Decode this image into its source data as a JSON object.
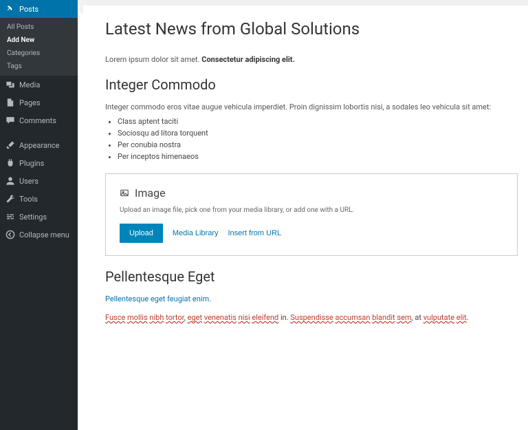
{
  "sidebar": {
    "posts": {
      "label": "Posts"
    },
    "sub": {
      "all": "All Posts",
      "add": "Add New",
      "cat": "Categories",
      "tags": "Tags"
    },
    "media": "Media",
    "pages": "Pages",
    "comments": "Comments",
    "appearance": "Appearance",
    "plugins": "Plugins",
    "users": "Users",
    "tools": "Tools",
    "settings": "Settings",
    "collapse": "Collapse menu"
  },
  "content": {
    "title": "Latest News from Global Solutions",
    "intro_plain": "Lorem ipsum dolor sit amet. ",
    "intro_bold": "Consectetur adipiscing elit.",
    "h2a": "Integer Commodo",
    "p2": "Integer commodo eros vitae augue vehicula imperdiet. Proin dignissim lobortis nisi, a sodales leo vehicula sit amet:",
    "bullets": [
      "Class aptent taciti",
      "Sociosqu ad litora torquent",
      "Per conubia nostra",
      "Per inceptos himenaeos"
    ],
    "image_block": {
      "label": "Image",
      "desc": "Upload an image file, pick one from your media library, or add one with a URL.",
      "upload": "Upload",
      "media_library": "Media Library",
      "insert_url": "Insert from URL"
    },
    "h2b": "Pellentesque Eget",
    "link_para": "Pellentesque eget feugiat enim.",
    "spell": {
      "w1": "Fusce",
      "w2": "mollis",
      "w3": "nibh",
      "w4": "tortor",
      "c1": ", ",
      "w5": "eget",
      "w6": "venenatis",
      "w7": "nisi",
      "w8": "eleifend",
      "p1": " in. ",
      "w9": "Suspendisse",
      "w10": "accumsan",
      "w11": "blandit",
      "w12": "sem",
      "c2": ", at ",
      "w13": "vulputate",
      "w14": "elit",
      "end": "."
    }
  }
}
